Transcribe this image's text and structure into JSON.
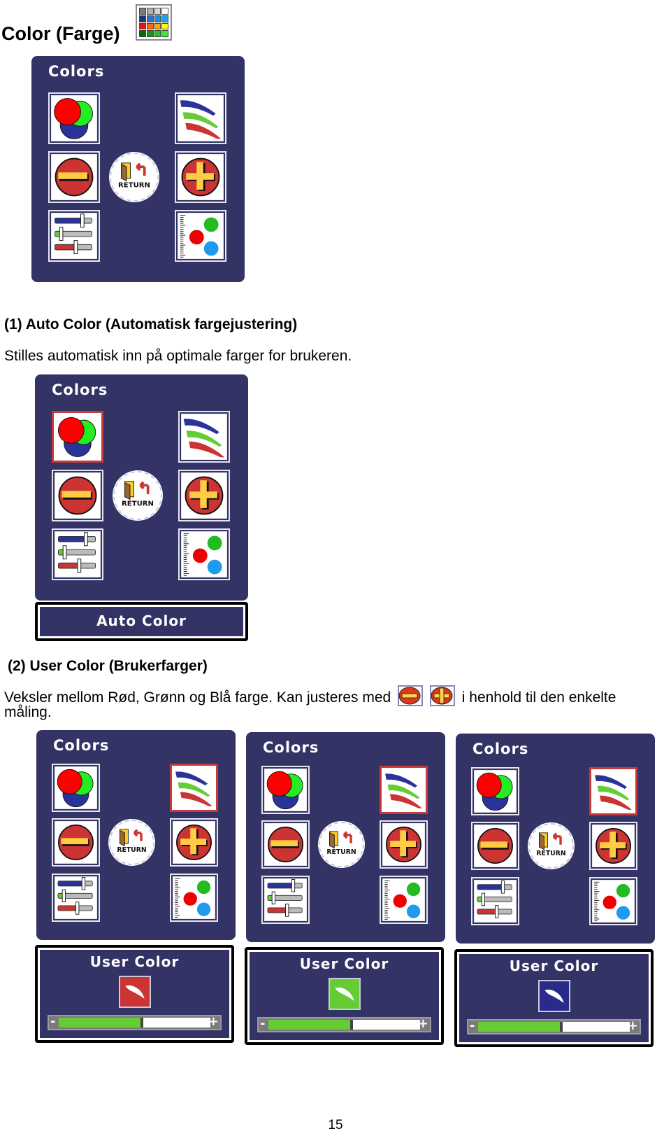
{
  "page": {
    "title": "Color (Farge)",
    "title_icon": "color-palette-icon",
    "palette_colors": [
      "#7a7a7a",
      "#b0b0b0",
      "#d4d4d4",
      "#ffffff",
      "#1f3568",
      "#3a6fc0",
      "#1e8fe0",
      "#1aa8e8",
      "#e51414",
      "#ff6a00",
      "#ffa800",
      "#ffff00",
      "#0a6a0a",
      "#169a16",
      "#22c222",
      "#33ee33"
    ],
    "page_number": "15"
  },
  "osd": {
    "panel_title": "Colors",
    "buttons": [
      {
        "name": "auto-color",
        "icon": "rgb-circles-icon"
      },
      {
        "name": "user-color",
        "icon": "color-strokes-icon"
      },
      {
        "name": "decrease",
        "icon": "minus-icon"
      },
      {
        "name": "return",
        "icon": "return-door-icon",
        "label": "RETURN"
      },
      {
        "name": "increase",
        "icon": "plus-icon"
      },
      {
        "name": "color-sliders",
        "icon": "rgb-sliders-icon"
      },
      {
        "name": "color-dots",
        "icon": "rgb-dots-icon"
      }
    ]
  },
  "section1": {
    "heading": "(1) Auto Color (Automatisk fargejustering)",
    "text": "Stilles automatisk inn på optimale farger for brukeren.",
    "status_label": "Auto Color",
    "selected": "auto-color"
  },
  "section2": {
    "heading": "(2) User Color (Brukerfarger)",
    "text_before": "Veksler mellom Rød, Grønn og Blå farge. Kan justeres med",
    "text_after": "i henhold til den enkelte",
    "text_wrap": "måling.",
    "inline_icons": [
      "minus-icon",
      "plus-icon"
    ],
    "selected": "user-color",
    "status_label": "User Color",
    "variants": [
      {
        "channel": "Red",
        "swatch_color": "#cc3333",
        "level_percent": 55
      },
      {
        "channel": "Green",
        "swatch_color": "#66cc33",
        "level_percent": 55
      },
      {
        "channel": "Blue",
        "swatch_color": "#2a2a8a",
        "level_percent": 55
      }
    ],
    "slider_minus": "-",
    "slider_plus": "+"
  }
}
